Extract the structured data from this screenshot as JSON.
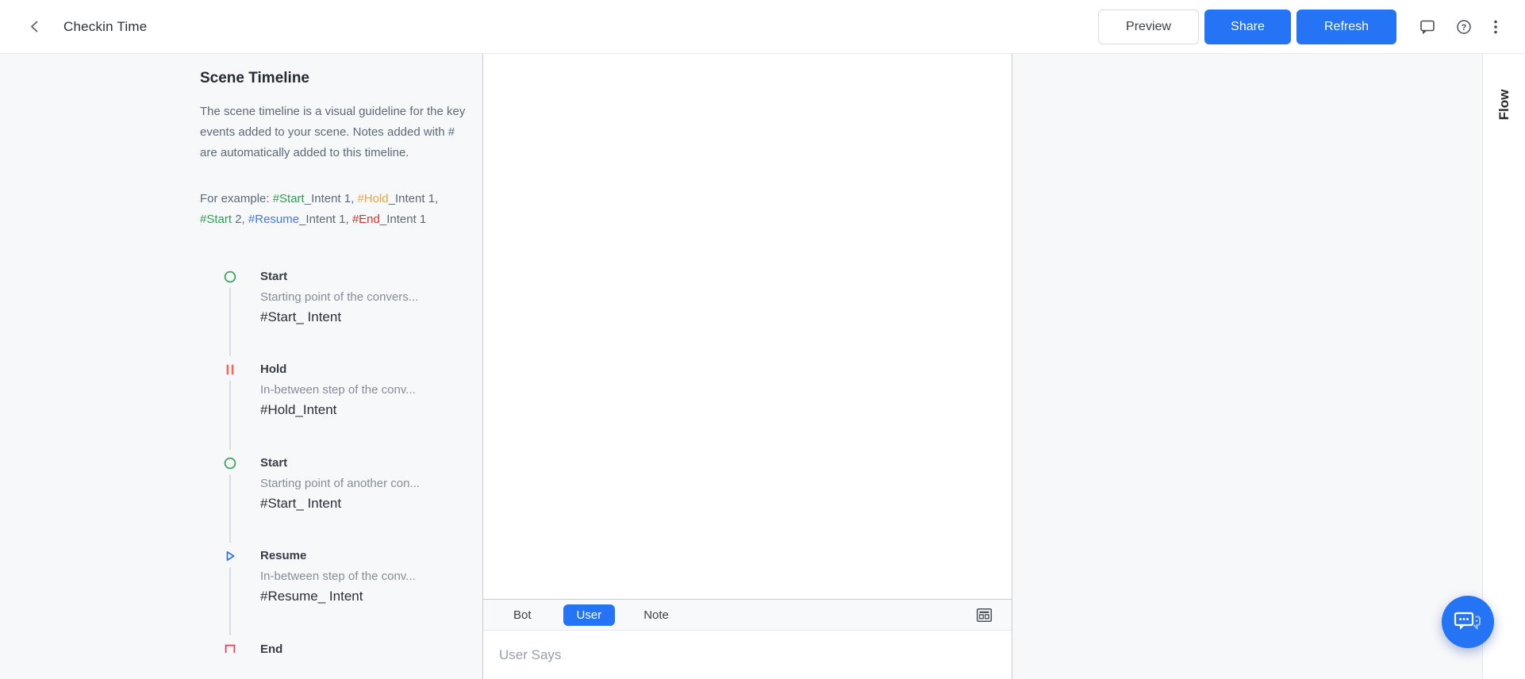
{
  "header": {
    "title": "Checkin Time",
    "buttons": {
      "preview": "Preview",
      "share": "Share",
      "refresh": "Refresh"
    }
  },
  "sidebar": {
    "title": "Scene Timeline",
    "description": "The scene timeline is a visual guideline for the key events added to your scene. Notes added with # are automatically added to this timeline.",
    "example": {
      "segments": [
        {
          "text": "For example: ",
          "color": "gray"
        },
        {
          "text": "#Start",
          "color": "green"
        },
        {
          "text": "_Intent 1, ",
          "color": "gray"
        },
        {
          "text": "#Hold",
          "color": "orange"
        },
        {
          "text": "_Intent 1, ",
          "color": "gray"
        },
        {
          "text": "#Start",
          "color": "green"
        },
        {
          "text": " 2, ",
          "color": "gray"
        },
        {
          "text": "#Resume",
          "color": "blue"
        },
        {
          "text": "_Intent 1, ",
          "color": "gray"
        },
        {
          "text": "#End",
          "color": "red"
        },
        {
          "text": "_Intent 1",
          "color": "gray"
        }
      ]
    },
    "items": [
      {
        "icon": "start-circle-icon",
        "title": "Start",
        "description": "Starting point of the convers...",
        "intent": "#Start_ Intent"
      },
      {
        "icon": "hold-pause-icon",
        "title": "Hold",
        "description": "In-between step of the conv...",
        "intent": "#Hold_Intent"
      },
      {
        "icon": "start-circle-icon",
        "title": "Start",
        "description": "Starting point of another con...",
        "intent": "#Start_ Intent"
      },
      {
        "icon": "resume-play-icon",
        "title": "Resume",
        "description": "In-between step of the conv...",
        "intent": "#Resume_ Intent"
      },
      {
        "icon": "end-square-icon",
        "title": "End",
        "description": "",
        "intent": ""
      }
    ]
  },
  "composer": {
    "tabs": [
      "Bot",
      "User",
      "Note"
    ],
    "active_tab": "User",
    "input_placeholder": "User Says"
  },
  "flow_panel": {
    "label": "Flow"
  },
  "colors": {
    "primary_blue": "#2574f5",
    "start_green": "#3aa757",
    "hold_coral": "#f4695c",
    "resume_blue": "#2f6df2",
    "end_red": "#e8425c",
    "tag_green": "#2f9e4f",
    "tag_orange": "#f2a33c",
    "tag_blue": "#4377f2",
    "tag_red": "#d93025"
  }
}
